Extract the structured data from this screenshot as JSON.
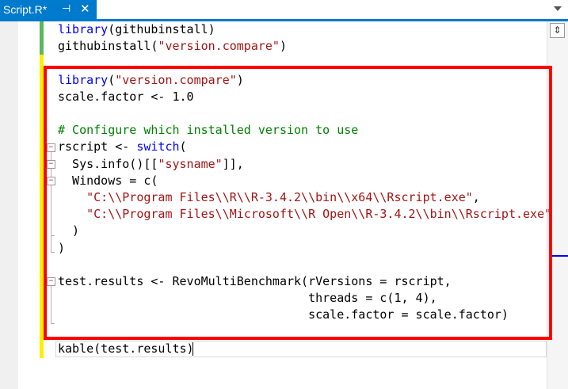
{
  "tab": {
    "title": "Script.R*",
    "pin_glyph": "⊣",
    "close_glyph": "✕"
  },
  "editor": {
    "lines": [
      {
        "segments": [
          {
            "cls": "kw",
            "text": "library"
          },
          {
            "cls": "",
            "text": "(githubinstall)"
          }
        ]
      },
      {
        "segments": [
          {
            "cls": "",
            "text": "githubinstall("
          },
          {
            "cls": "str",
            "text": "\"version.compare\""
          },
          {
            "cls": "",
            "text": ")"
          }
        ]
      },
      {
        "segments": []
      },
      {
        "segments": [
          {
            "cls": "kw",
            "text": "library"
          },
          {
            "cls": "",
            "text": "("
          },
          {
            "cls": "str",
            "text": "\"version.compare\""
          },
          {
            "cls": "",
            "text": ")"
          }
        ]
      },
      {
        "segments": [
          {
            "cls": "",
            "text": "scale.factor <- 1.0"
          }
        ]
      },
      {
        "segments": []
      },
      {
        "segments": [
          {
            "cls": "cm",
            "text": "# Configure which installed version to use"
          }
        ]
      },
      {
        "segments": [
          {
            "cls": "",
            "text": "rscript <- "
          },
          {
            "cls": "kw",
            "text": "switch"
          },
          {
            "cls": "",
            "text": "("
          }
        ]
      },
      {
        "segments": [
          {
            "cls": "",
            "text": "  Sys.info()[["
          },
          {
            "cls": "str",
            "text": "\"sysname\""
          },
          {
            "cls": "",
            "text": "]],"
          }
        ]
      },
      {
        "segments": [
          {
            "cls": "",
            "text": "  Windows = c("
          }
        ]
      },
      {
        "segments": [
          {
            "cls": "",
            "text": "    "
          },
          {
            "cls": "str",
            "text": "\"C:\\\\Program Files\\\\R\\\\R-3.4.2\\\\bin\\\\x64\\\\Rscript.exe\""
          },
          {
            "cls": "",
            "text": ","
          }
        ]
      },
      {
        "segments": [
          {
            "cls": "",
            "text": "    "
          },
          {
            "cls": "str",
            "text": "\"C:\\\\Program Files\\\\Microsoft\\\\R Open\\\\R-3.4.2\\\\bin\\\\Rscript.exe\""
          }
        ]
      },
      {
        "segments": [
          {
            "cls": "",
            "text": "  )"
          }
        ]
      },
      {
        "segments": [
          {
            "cls": "",
            "text": ")"
          }
        ]
      },
      {
        "segments": []
      },
      {
        "segments": [
          {
            "cls": "",
            "text": "test.results <- RevoMultiBenchmark(rVersions = rscript,"
          }
        ]
      },
      {
        "segments": [
          {
            "cls": "",
            "text": "                                   threads = c(1, 4),"
          }
        ]
      },
      {
        "segments": [
          {
            "cls": "",
            "text": "                                   scale.factor = scale.factor)"
          }
        ]
      },
      {
        "segments": []
      },
      {
        "segments": [
          {
            "cls": "",
            "text": "kable(test.results)"
          }
        ]
      }
    ]
  },
  "colors": {
    "tab_active": "#007acc",
    "highlight_border": "#ff0000",
    "change_saved": "#5cb85c",
    "change_unsaved": "#ffee00",
    "keyword": "#0000ff",
    "string": "#a31515",
    "comment": "#008000"
  },
  "icons": {
    "pin": "pin-icon",
    "close": "close-icon",
    "dropdown": "chevron-down-icon",
    "split": "split-icon"
  }
}
